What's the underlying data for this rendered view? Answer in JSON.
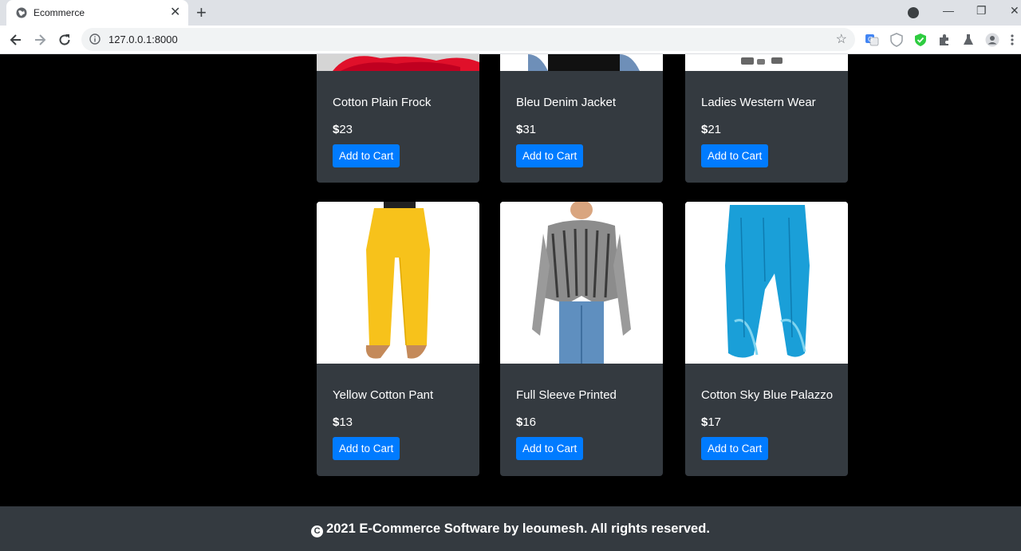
{
  "browser": {
    "tab_title": "Ecommerce",
    "tab_close": "✕",
    "new_tab": "+",
    "url": "127.0.0.1:8000",
    "minimize": "—",
    "restore": "❐",
    "close": "✕"
  },
  "products": [
    {
      "name": "Cotton Plain Frock",
      "currency": "$",
      "amount": "23",
      "button": "Add to Cart"
    },
    {
      "name": "Bleu Denim Jacket",
      "currency": "$",
      "amount": "31",
      "button": "Add to Cart"
    },
    {
      "name": "Ladies Western Wear",
      "currency": "$",
      "amount": "21",
      "button": "Add to Cart"
    },
    {
      "name": "Yellow Cotton Pant",
      "currency": "$",
      "amount": "13",
      "button": "Add to Cart"
    },
    {
      "name": "Full Sleeve Printed",
      "currency": "$",
      "amount": "16",
      "button": "Add to Cart"
    },
    {
      "name": "Cotton Sky Blue Palazzo",
      "currency": "$",
      "amount": "17",
      "button": "Add to Cart"
    }
  ],
  "footer": {
    "copyright_symbol": "C",
    "text": "2021 E-Commerce Software by leoumesh. All rights reserved."
  },
  "colors": {
    "card_bg": "#343a40",
    "button_bg": "#007bff",
    "page_bg": "#000000"
  }
}
